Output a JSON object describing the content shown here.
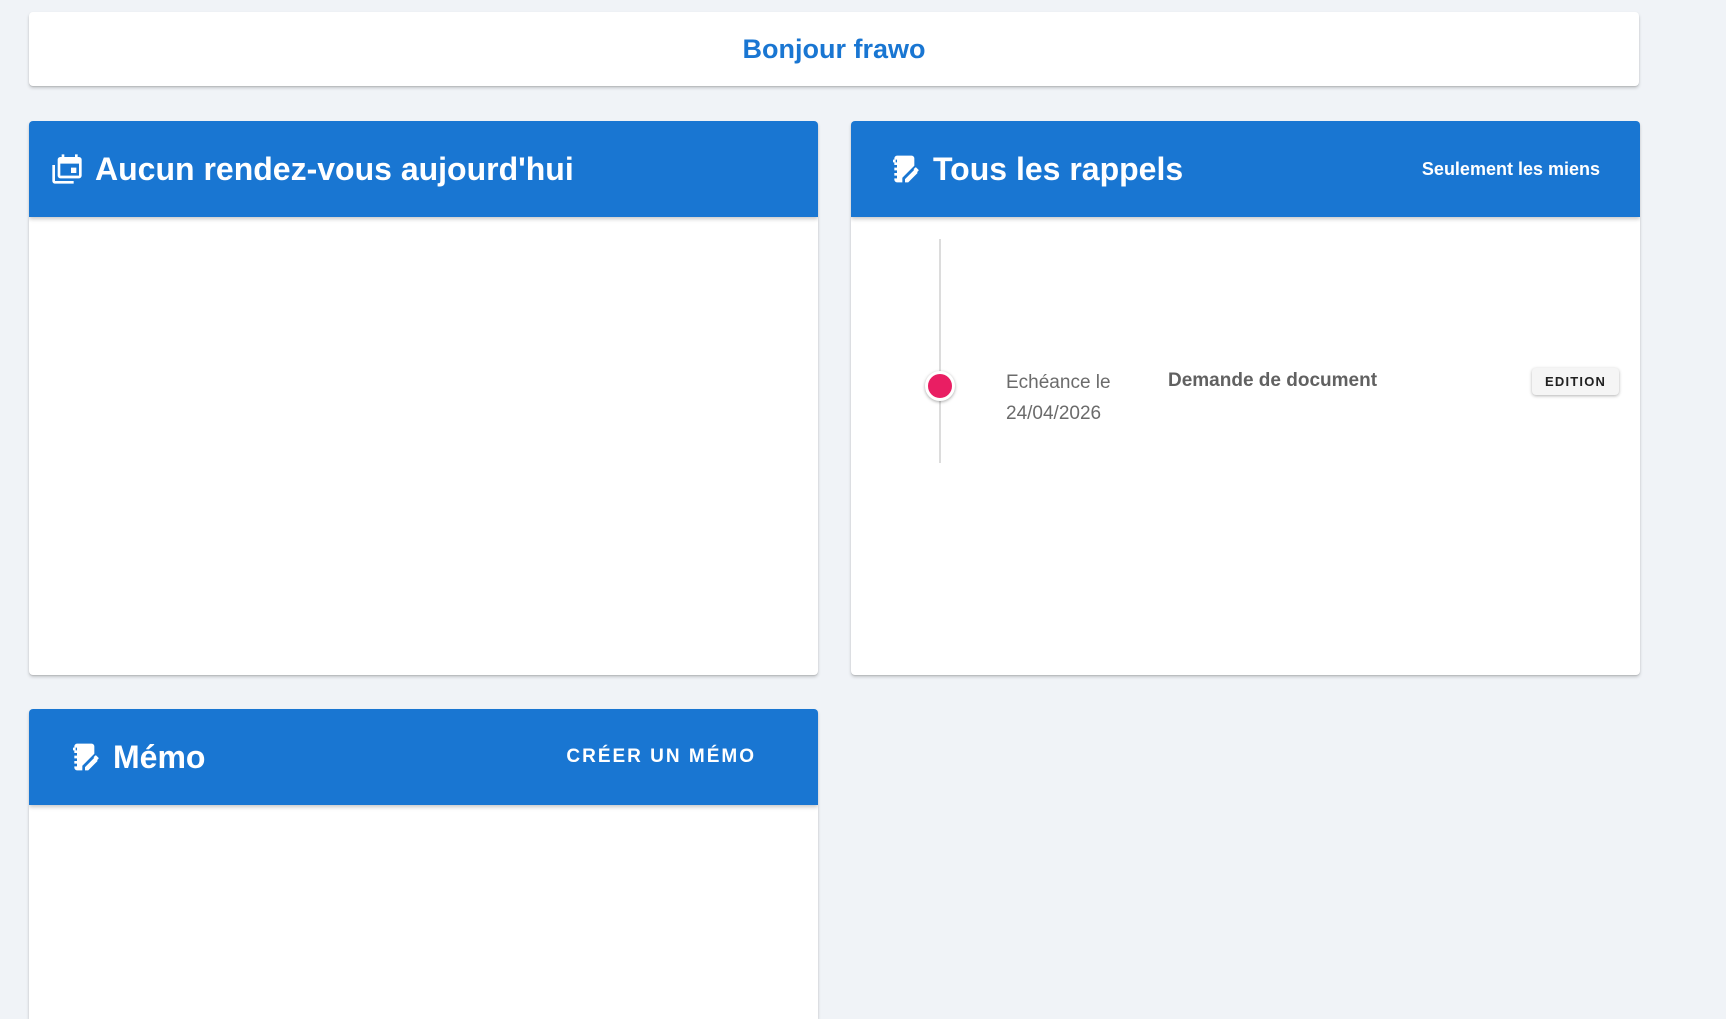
{
  "greeting": {
    "text": "Bonjour frawo"
  },
  "appointments": {
    "title": "Aucun rendez-vous aujourd'hui",
    "icon": "calendar-multiple-icon"
  },
  "reminders": {
    "title": "Tous les rappels",
    "icon": "notebook-edit-icon",
    "filter_label": "Seulement les miens",
    "items": [
      {
        "due_label": "Echéance le",
        "due_date": "24/04/2026",
        "title": "Demande de document",
        "edit_label": "EDITION",
        "dot_color": "#e91e63"
      }
    ]
  },
  "memo": {
    "title": "Mémo",
    "icon": "notebook-edit-icon",
    "create_label": "CRÉER UN MÉMO"
  },
  "colors": {
    "primary": "#1976d2",
    "accent": "#e91e63",
    "background": "#f0f3f7"
  }
}
